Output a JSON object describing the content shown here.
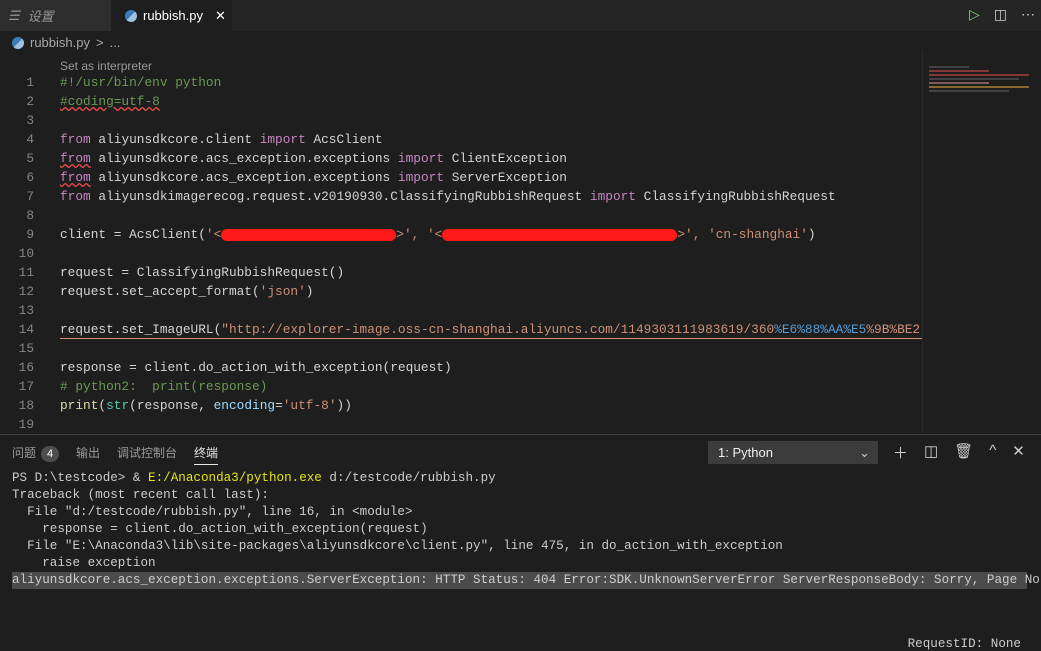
{
  "tabs": [
    {
      "label": "设置",
      "icon": "settings-list-icon"
    },
    {
      "label": "rubbish.py",
      "icon": "python-icon"
    }
  ],
  "breadcrumb": {
    "file": "rubbish.py",
    "sep": ">",
    "rest": "..."
  },
  "codelens": "Set as interpreter",
  "code": {
    "l1": "#!/usr/bin/env python",
    "l2": "#coding=utf-8",
    "from": "from",
    "import": "import",
    "l4a": "aliyunsdkcore.client",
    "l4b": "AcsClient",
    "l5a": "aliyunsdkcore.acs_exception.exceptions",
    "l5b": "ClientException",
    "l6a": "aliyunsdkcore.acs_exception.exceptions",
    "l6b": "ServerException",
    "l7a": "aliyunsdkimagerecog.request.v20190930.ClassifyingRubbishRequest",
    "l7b": "ClassifyingRubbishRequest",
    "l9a": "client = AcsClient(",
    "l9b": "'<",
    "l9c": ">', ",
    "l9d": "'<",
    "l9e": ">', ",
    "l9f": "'cn-shanghai'",
    "l9g": ")",
    "l11": "request = ClassifyingRubbishRequest()",
    "l12a": "request.set_accept_format(",
    "l12b": "'json'",
    "l12c": ")",
    "l14a": "request.set_ImageURL(",
    "l14b": "\"http://explorer-image.oss-cn-shanghai.aliyuncs.com/1149303111983619/360",
    "l14c": "%E6%88%AA%E5",
    "l14d": "%9B%BE2",
    "l16": "response = client.do_action_with_exception(request)",
    "l17": "# python2:  print(response)",
    "l18a": "print",
    "l18b": "(",
    "l18c": "str",
    "l18d": "(response, ",
    "l18e": "encoding",
    "l18f": "=",
    "l18g": "'utf-8'",
    "l18h": "))"
  },
  "panel": {
    "tabs": [
      {
        "label": "问题",
        "badge": "4"
      },
      {
        "label": "输出"
      },
      {
        "label": "调试控制台"
      },
      {
        "label": "终端",
        "active": true
      }
    ],
    "terminal_select": "1: Python",
    "terminal": {
      "p1": "PS D:\\testcode> & ",
      "p2": "E:/Anaconda3/python.exe",
      "p3": " d:/testcode/rubbish.py",
      "t1": "Traceback (most recent call last):",
      "t2": "  File \"d:/testcode/rubbish.py\", line 16, in <module>",
      "t3": "    response = client.do_action_with_exception(request)",
      "t4": "  File \"E:\\Anaconda3\\lib\\site-packages\\aliyunsdkcore\\client.py\", line 475, in do_action_with_exception",
      "t5": "    raise exception",
      "t6": "aliyunsdkcore.acs_exception.exceptions.ServerException: HTTP Status: 404 Error:SDK.UnknownServerError ServerResponseBody: Sorry, Page Not Found",
      "t7": "RequestID: None"
    }
  },
  "colors": {
    "accent_yellow": "#e5e510",
    "string": "#ce9178",
    "keyword": "#c586c0",
    "comment": "#6a9955"
  }
}
